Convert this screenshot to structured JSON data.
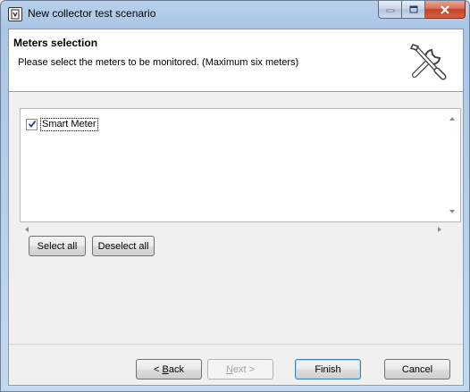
{
  "window": {
    "title": "New collector test scenario"
  },
  "header": {
    "title": "Meters selection",
    "description": "Please select the meters to be monitored. (Maximum six meters)",
    "icon": "tools-icon"
  },
  "meters": {
    "items": [
      {
        "label": "Smart Meter",
        "checked": true
      }
    ]
  },
  "list_buttons": {
    "select_all": "Select all",
    "deselect_all": "Deselect all"
  },
  "nav_buttons": {
    "back_prefix": "< ",
    "back_underlined": "B",
    "back_rest": "ack",
    "next_underlined": "N",
    "next_rest": "ext >",
    "finish": "Finish",
    "cancel": "Cancel"
  }
}
